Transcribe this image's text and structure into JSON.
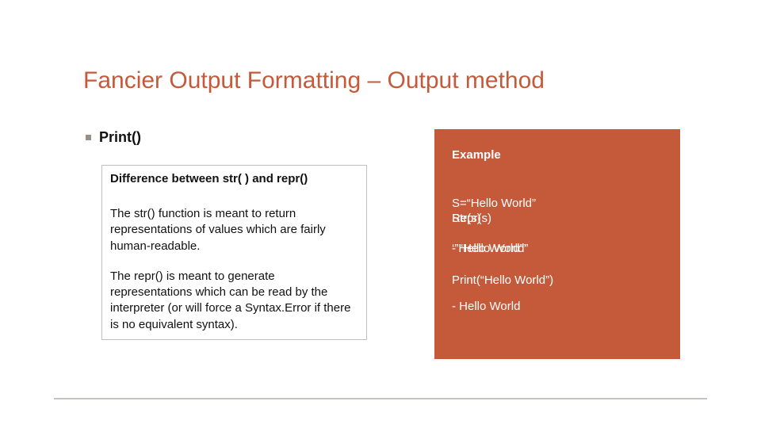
{
  "title": "Fancier Output Formatting – Output method",
  "bullet": "Print()",
  "left": {
    "subhead": "Difference between str( ) and repr()",
    "p1": "The str() function is meant to return representations of values which are fairly human-readable.",
    "p2": "The repr() is meant to generate representations which can be read by the interpreter (or will force a Syntax.Error if there is no equivalent syntax)."
  },
  "right": {
    "heading": "Example",
    "l1": "S=“Hello World”",
    "stack_a1": "Repr(s)",
    "stack_a2": "Str(s)",
    "stack_b1": "- “Hello World”",
    "stack_b2": "‘”Hello World”’",
    "l4": "Print(“Hello World”)",
    "l5": "- Hello World"
  }
}
